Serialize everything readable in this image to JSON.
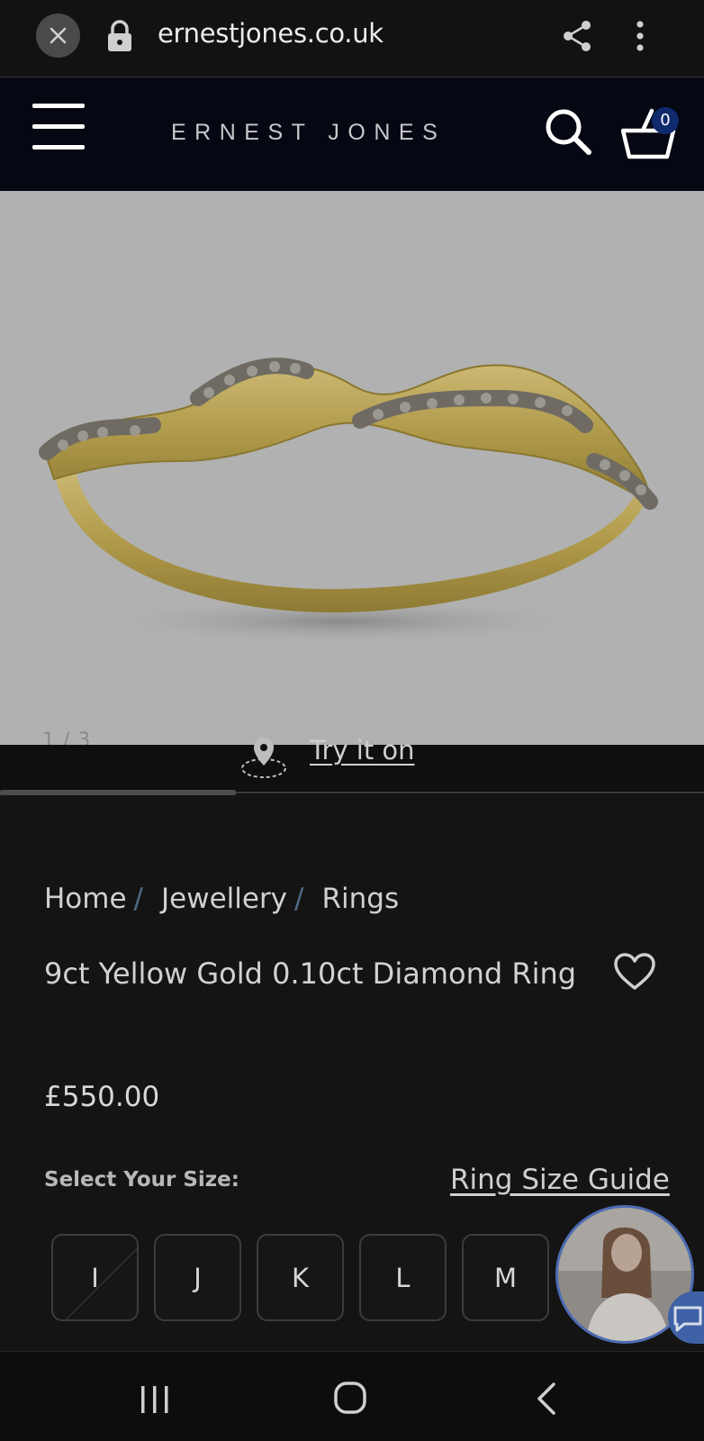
{
  "browser": {
    "url": "ernestjones.co.uk"
  },
  "header": {
    "logo": "ERNEST JONES",
    "cart_count": "0"
  },
  "gallery": {
    "counter": "1 / 3",
    "try_on_label": "Try it on",
    "progress": 0.333
  },
  "breadcrumb": {
    "items": [
      "Home",
      "Jewellery",
      "Rings"
    ],
    "separator": "/"
  },
  "product": {
    "title": "9ct Yellow Gold 0.10ct Diamond Ring",
    "price": "£550.00"
  },
  "size_selector": {
    "label": "Select Your Size:",
    "guide_link": "Ring Size Guide",
    "options": [
      "I",
      "J",
      "K",
      "L",
      "M"
    ]
  },
  "colors": {
    "header_bg": "#050713",
    "page_bg": "#141414",
    "cart_badge": "#0f2b6e",
    "ring_gold": "#b9a45a"
  },
  "icons": {
    "browser_close": "close-icon",
    "browser_lock": "lock-icon",
    "browser_share": "share-icon",
    "browser_more": "more-vertical-icon",
    "menu": "hamburger-menu-icon",
    "search": "search-icon",
    "cart": "basket-icon",
    "try_on": "ar-try-on-icon",
    "wishlist": "heart-icon",
    "chat": "chat-bubble-icon"
  }
}
